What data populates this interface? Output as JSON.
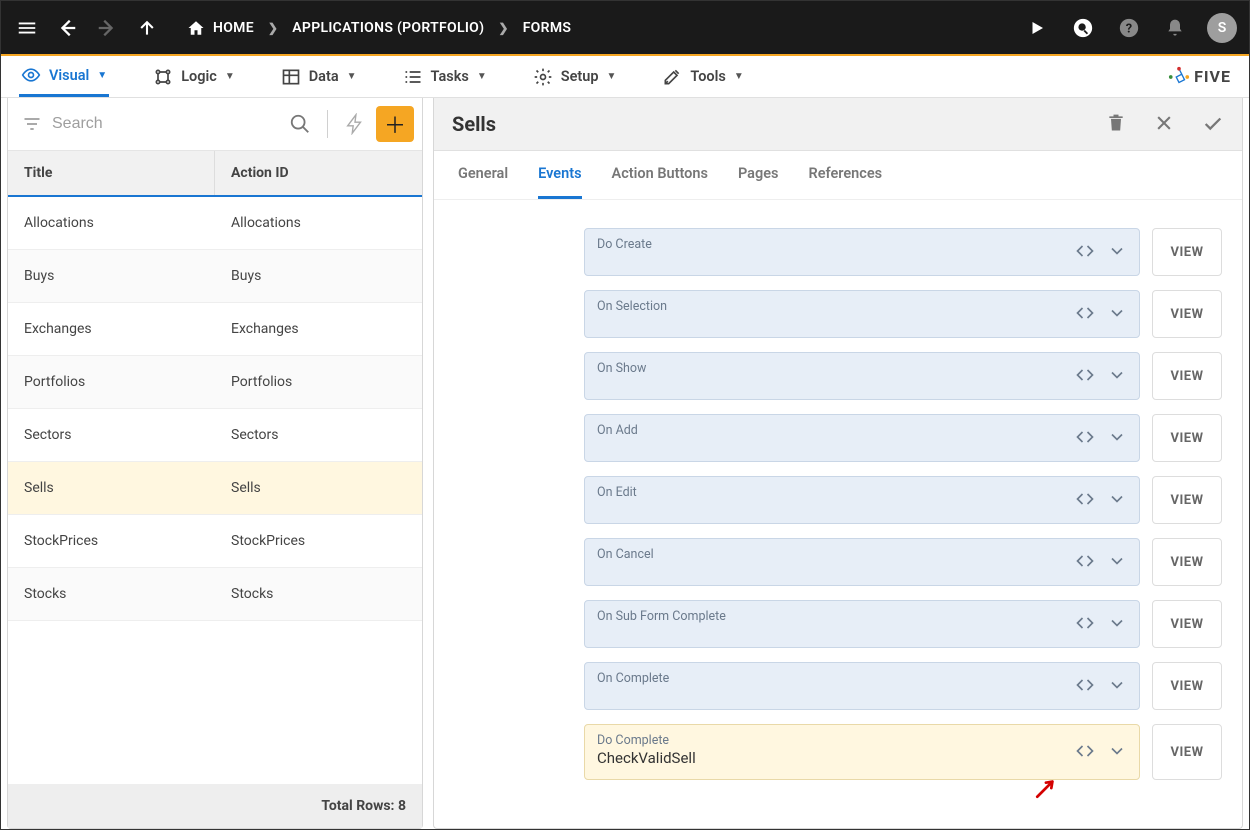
{
  "topbar": {
    "breadcrumb": [
      "HOME",
      "APPLICATIONS (PORTFOLIO)",
      "FORMS"
    ],
    "avatar_letter": "S"
  },
  "menubar": {
    "items": [
      {
        "label": "Visual",
        "active": true
      },
      {
        "label": "Logic",
        "active": false
      },
      {
        "label": "Data",
        "active": false
      },
      {
        "label": "Tasks",
        "active": false
      },
      {
        "label": "Setup",
        "active": false
      },
      {
        "label": "Tools",
        "active": false
      }
    ],
    "brand": "FIVE"
  },
  "leftpane": {
    "search_placeholder": "Search",
    "columns": {
      "title": "Title",
      "action_id": "Action ID"
    },
    "rows": [
      {
        "title": "Allocations",
        "action_id": "Allocations",
        "selected": false
      },
      {
        "title": "Buys",
        "action_id": "Buys",
        "selected": false
      },
      {
        "title": "Exchanges",
        "action_id": "Exchanges",
        "selected": false
      },
      {
        "title": "Portfolios",
        "action_id": "Portfolios",
        "selected": false
      },
      {
        "title": "Sectors",
        "action_id": "Sectors",
        "selected": false
      },
      {
        "title": "Sells",
        "action_id": "Sells",
        "selected": true
      },
      {
        "title": "StockPrices",
        "action_id": "StockPrices",
        "selected": false
      },
      {
        "title": "Stocks",
        "action_id": "Stocks",
        "selected": false
      }
    ],
    "footer": "Total Rows: 8"
  },
  "rightpane": {
    "title": "Sells",
    "tabs": [
      {
        "label": "General",
        "active": false
      },
      {
        "label": "Events",
        "active": true
      },
      {
        "label": "Action Buttons",
        "active": false
      },
      {
        "label": "Pages",
        "active": false
      },
      {
        "label": "References",
        "active": false
      }
    ],
    "events": [
      {
        "label": "Do Create",
        "value": "",
        "highlight": false
      },
      {
        "label": "On Selection",
        "value": "",
        "highlight": false
      },
      {
        "label": "On Show",
        "value": "",
        "highlight": false
      },
      {
        "label": "On Add",
        "value": "",
        "highlight": false
      },
      {
        "label": "On Edit",
        "value": "",
        "highlight": false
      },
      {
        "label": "On Cancel",
        "value": "",
        "highlight": false
      },
      {
        "label": "On Sub Form Complete",
        "value": "",
        "highlight": false
      },
      {
        "label": "On Complete",
        "value": "",
        "highlight": false
      },
      {
        "label": "Do Complete",
        "value": "CheckValidSell",
        "highlight": true
      }
    ],
    "view_label": "VIEW"
  }
}
